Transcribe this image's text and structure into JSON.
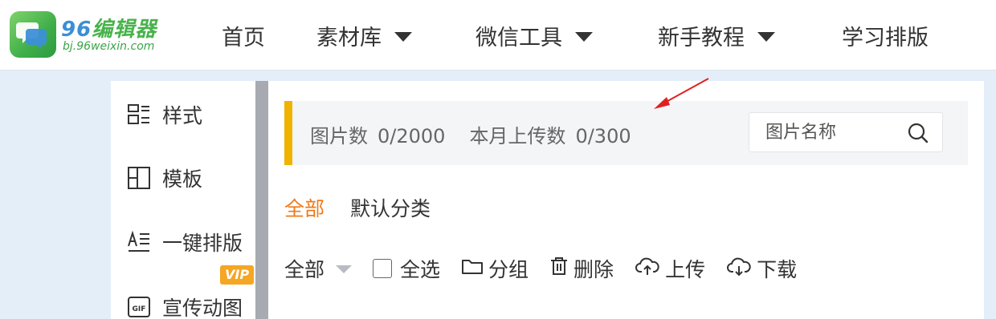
{
  "logo": {
    "title_num": "96",
    "title_cn": "编辑器",
    "subtitle": "bj.96weixin.com",
    "brand_color": "#47b34b"
  },
  "nav": {
    "items": [
      {
        "label": "首页",
        "has_dropdown": false
      },
      {
        "label": "素材库",
        "has_dropdown": true
      },
      {
        "label": "微信工具",
        "has_dropdown": true
      },
      {
        "label": "新手教程",
        "has_dropdown": true
      },
      {
        "label": "学习排版",
        "has_dropdown": false
      }
    ]
  },
  "sidebar": {
    "items": [
      {
        "label": "样式",
        "icon": "style-icon"
      },
      {
        "label": "模板",
        "icon": "template-icon"
      },
      {
        "label": "一键排版",
        "icon": "text-format-icon"
      },
      {
        "label": "宣传动图",
        "icon": "gif-icon"
      }
    ],
    "vip_badge": "VIP"
  },
  "stats": {
    "images_label": "图片数",
    "images_value": "0/2000",
    "uploads_label": "本月上传数",
    "uploads_value": "0/300",
    "accent_color": "#f0b400"
  },
  "search": {
    "placeholder": "图片名称"
  },
  "tabs": {
    "all": "全部",
    "default_category": "默认分类",
    "active_color": "#f07a1a"
  },
  "toolbar": {
    "filter": "全部",
    "select_all": "全选",
    "group": "分组",
    "delete": "删除",
    "upload": "上传",
    "download": "下载"
  },
  "annotation_color": "#e02020"
}
